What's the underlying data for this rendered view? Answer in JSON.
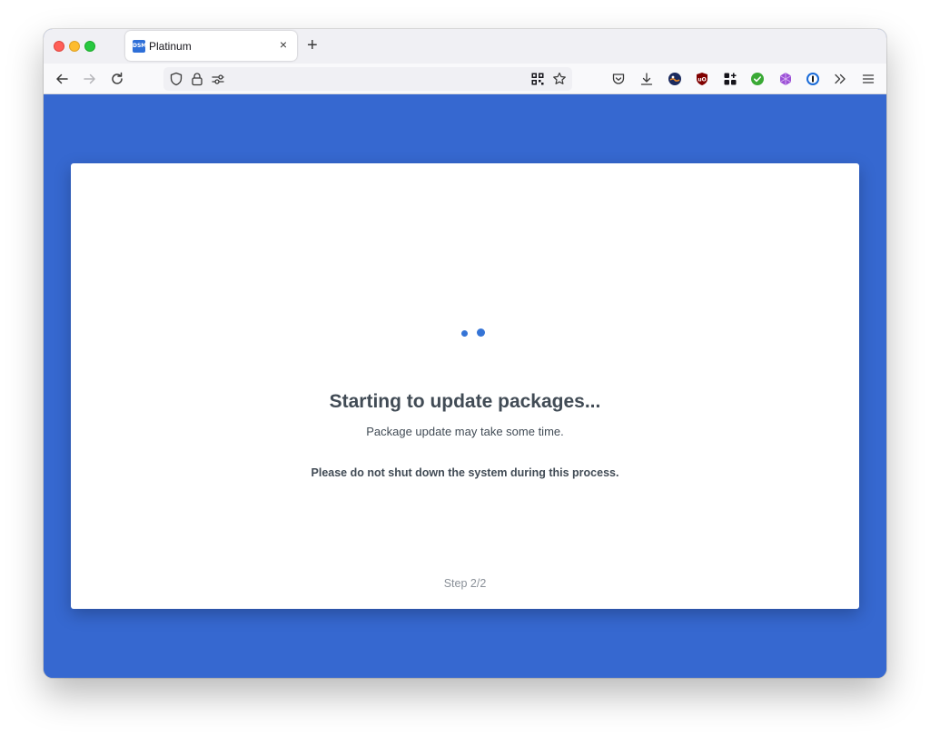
{
  "browser": {
    "tab_title": "Platinum",
    "tab_favicon_text": "DSM",
    "tab_close_glyph": "×",
    "new_tab_glyph": "+",
    "nav_icons": [
      "back-arrow-icon",
      "forward-arrow-icon",
      "reload-icon"
    ],
    "url_icons": [
      "shield-icon",
      "lock-icon",
      "permissions-icon"
    ],
    "url_right_icons": [
      "qr-code-icon",
      "bookmark-star-icon"
    ],
    "toolbar_icons": [
      "pocket-icon",
      "download-icon",
      "extension-globe-icon",
      "ublock-icon",
      "extensions-grid-icon",
      "check-circle-icon",
      "purple-extension-icon",
      "1password-icon",
      "overflow-chevrons-icon",
      "menu-icon"
    ]
  },
  "colors": {
    "page_background": "#3668d0",
    "card_background": "#ffffff",
    "text_primary": "#414b55",
    "text_muted": "#8a9098",
    "spinner": "#3574d6"
  },
  "update": {
    "title": "Starting to update packages...",
    "subtitle": "Package update may take some time.",
    "warning": "Please do not shut down the system during this process.",
    "step": "Step 2/2"
  }
}
